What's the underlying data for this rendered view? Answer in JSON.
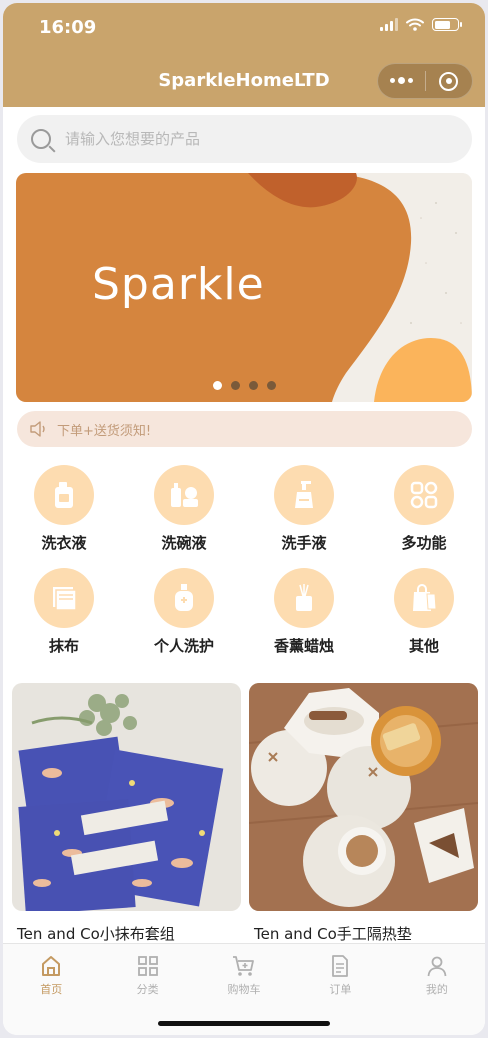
{
  "status_bar": {
    "time": "16:09"
  },
  "header": {
    "title": "SparkleHomeLTD",
    "more_icon": "more-dots-icon",
    "close_icon": "target-circle-icon"
  },
  "search": {
    "placeholder": "请输入您想要的产品",
    "value": ""
  },
  "banner": {
    "text": "Sparkle",
    "slide_count": 4,
    "active_slide": 1
  },
  "notice": {
    "text": "下单+送货须知!",
    "icon": "speaker-icon"
  },
  "categories": [
    {
      "label": "洗衣液",
      "icon": "detergent-bottle-icon"
    },
    {
      "label": "洗碗液",
      "icon": "dish-soap-icon"
    },
    {
      "label": "洗手液",
      "icon": "hand-soap-pump-icon"
    },
    {
      "label": "多功能",
      "icon": "grid-multi-icon"
    },
    {
      "label": "抹布",
      "icon": "cloth-icon"
    },
    {
      "label": "个人洗护",
      "icon": "personal-care-bottle-icon"
    },
    {
      "label": "香薰蜡烛",
      "icon": "candle-diffuser-icon"
    },
    {
      "label": "其他",
      "icon": "shopping-bag-icon"
    }
  ],
  "products": [
    {
      "name": "Ten and Co小抹布套组"
    },
    {
      "name": "Ten and Co手工隔热垫"
    }
  ],
  "tabbar": [
    {
      "label": "首页",
      "icon": "home-icon",
      "active": true
    },
    {
      "label": "分类",
      "icon": "category-grid-icon",
      "active": false
    },
    {
      "label": "购物车",
      "icon": "cart-icon",
      "active": false
    },
    {
      "label": "订单",
      "icon": "order-document-icon",
      "active": false
    },
    {
      "label": "我的",
      "icon": "profile-icon",
      "active": false
    }
  ],
  "colors": {
    "header": "#c9a46c",
    "accent": "#c49a62",
    "category_bg": "#fddcb0",
    "banner_orange": "#d5853e",
    "notice_bg": "#f6e6dc"
  }
}
